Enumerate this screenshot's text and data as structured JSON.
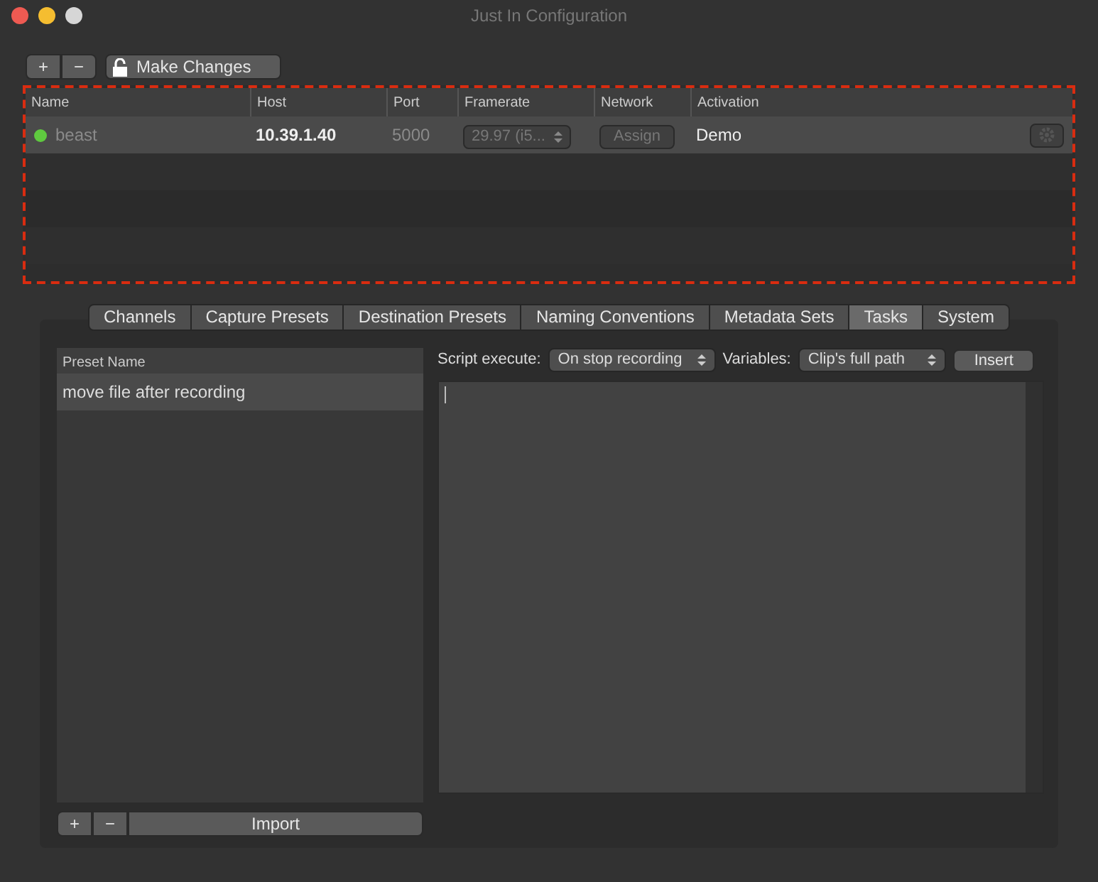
{
  "window": {
    "title": "Just In Configuration"
  },
  "toolbar": {
    "add": "+",
    "remove": "−",
    "make_changes": "Make Changes",
    "locked": false
  },
  "table": {
    "columns": [
      "Name",
      "Host",
      "Port",
      "Framerate",
      "Network",
      "Activation"
    ],
    "rows": [
      {
        "color": "#5fc93f",
        "name": "beast",
        "host": "10.39.1.40",
        "port": "5000",
        "framerate": "29.97 (i5...",
        "network": "Assign",
        "activation": "Demo",
        "selected": true
      }
    ]
  },
  "tabs": [
    {
      "label": "Channels",
      "selected": false
    },
    {
      "label": "Capture Presets",
      "selected": false
    },
    {
      "label": "Destination Presets",
      "selected": false
    },
    {
      "label": "Naming Conventions",
      "selected": false
    },
    {
      "label": "Metadata Sets",
      "selected": false
    },
    {
      "label": "Tasks",
      "selected": true
    },
    {
      "label": "System",
      "selected": false
    }
  ],
  "presets": {
    "column": "Preset Name",
    "items": [
      {
        "label": "move file after recording",
        "selected": true
      }
    ],
    "add": "+",
    "remove": "−",
    "import": "Import"
  },
  "script": {
    "execute_label": "Script execute:",
    "execute_value": "On stop recording",
    "variables_label": "Variables:",
    "variables_value": "Clip's full path",
    "insert": "Insert"
  }
}
